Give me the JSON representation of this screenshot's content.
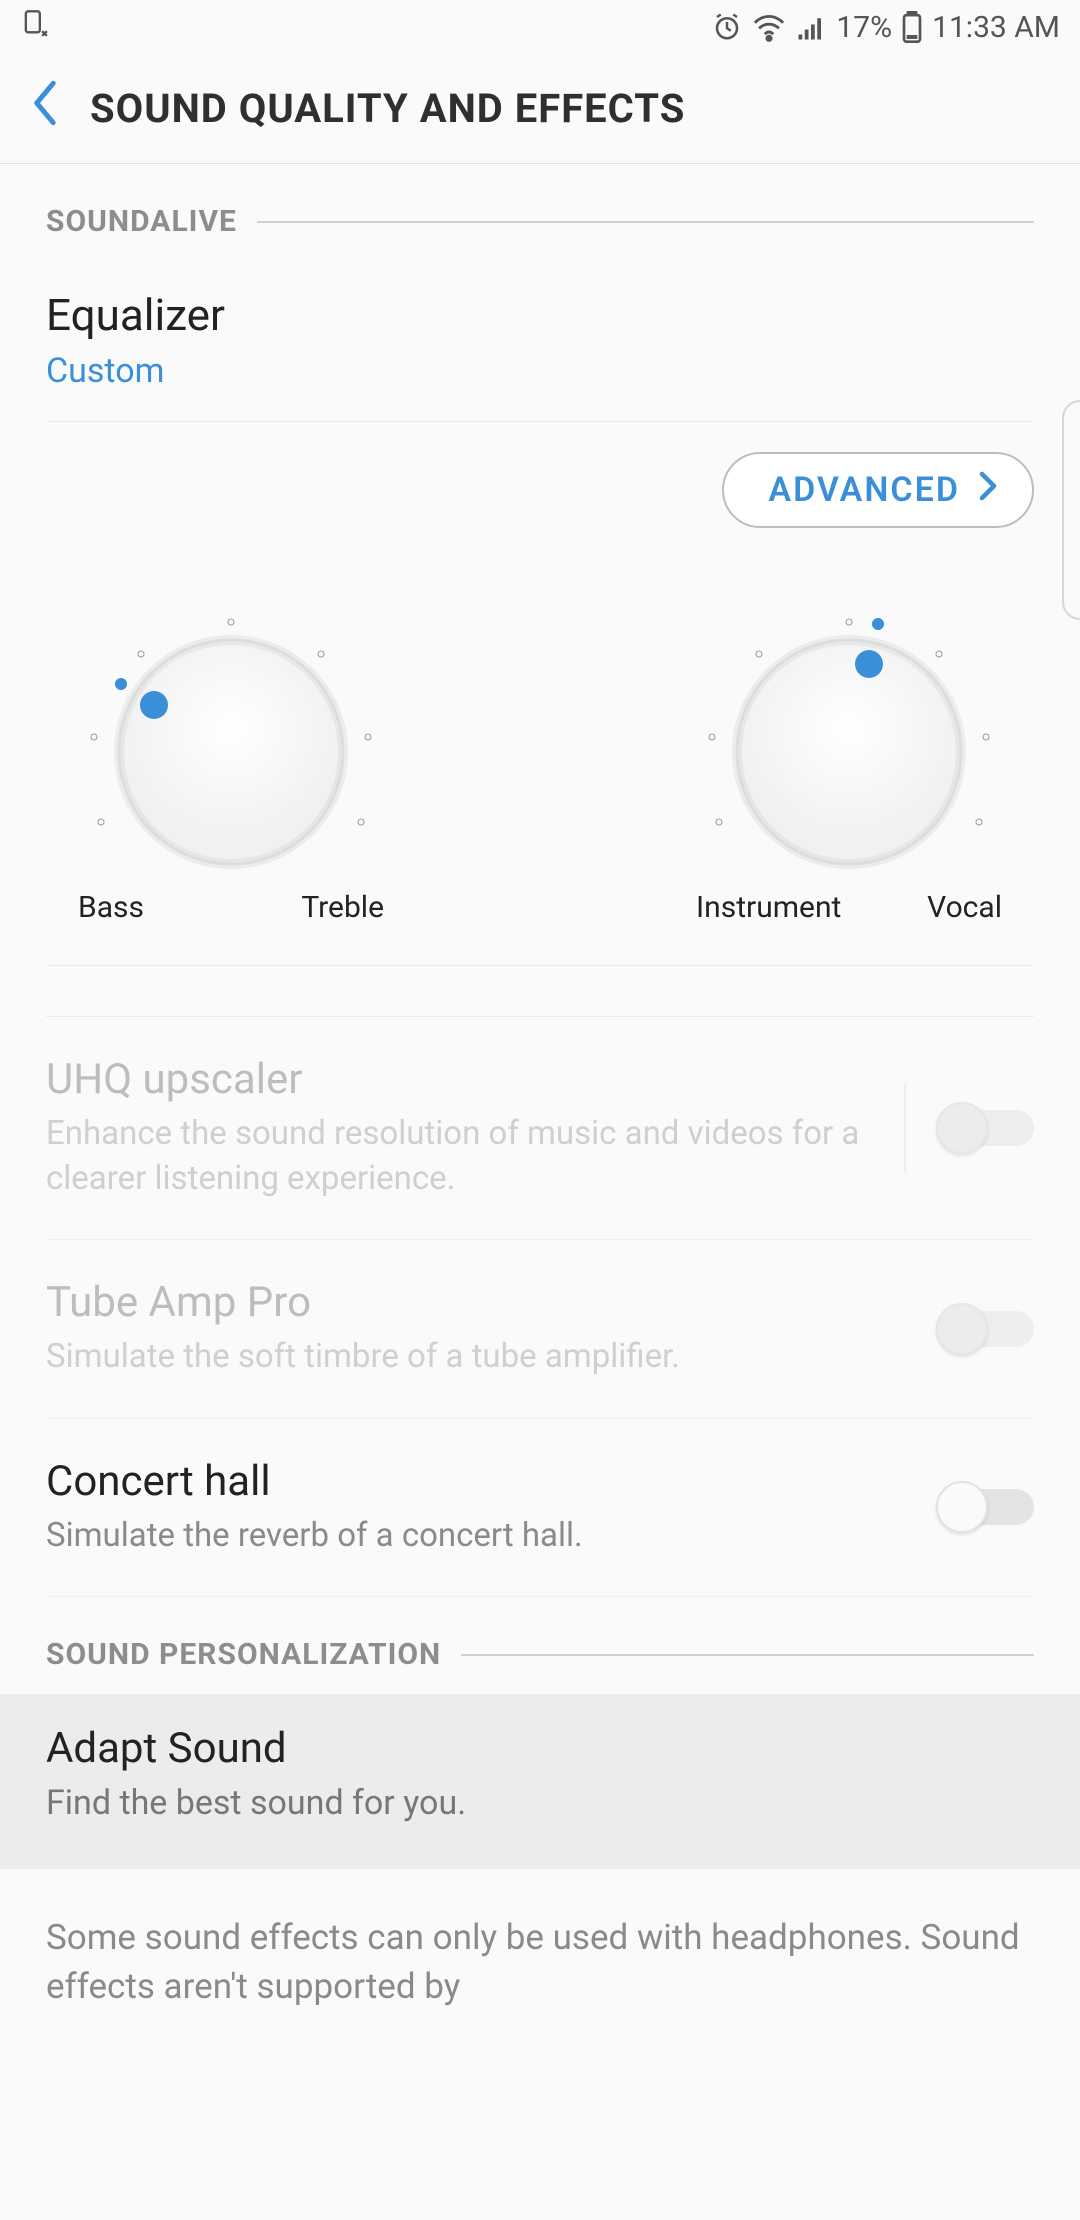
{
  "status": {
    "battery_pct": "17%",
    "time": "11:33 AM"
  },
  "header": {
    "title": "SOUND QUALITY AND EFFECTS"
  },
  "sections": {
    "soundalive": {
      "label": "SOUNDALIVE"
    },
    "personalization": {
      "label": "SOUND PERSONALIZATION"
    }
  },
  "equalizer": {
    "title": "Equalizer",
    "value": "Custom",
    "advanced_label": "ADVANCED"
  },
  "dials": {
    "left": {
      "low_label": "Bass",
      "high_label": "Treble",
      "angle_deg": -70
    },
    "right": {
      "low_label": "Instrument",
      "high_label": "Vocal",
      "angle_deg": 13
    }
  },
  "toggles": {
    "uhq": {
      "title": "UHQ upscaler",
      "desc": "Enhance the sound resolution of music and videos for a clearer listening experience.",
      "on": false,
      "enabled": false
    },
    "tube": {
      "title": "Tube Amp Pro",
      "desc": "Simulate the soft timbre of a tube amplifier.",
      "on": false,
      "enabled": false
    },
    "concert": {
      "title": "Concert hall",
      "desc": "Simulate the reverb of a concert hall.",
      "on": false,
      "enabled": true
    }
  },
  "adapt": {
    "title": "Adapt Sound",
    "desc": "Find the best sound for you."
  },
  "footnote": "Some sound effects can only be used with headphones. Sound effects aren't supported by",
  "colors": {
    "accent": "#3a8fd8"
  }
}
